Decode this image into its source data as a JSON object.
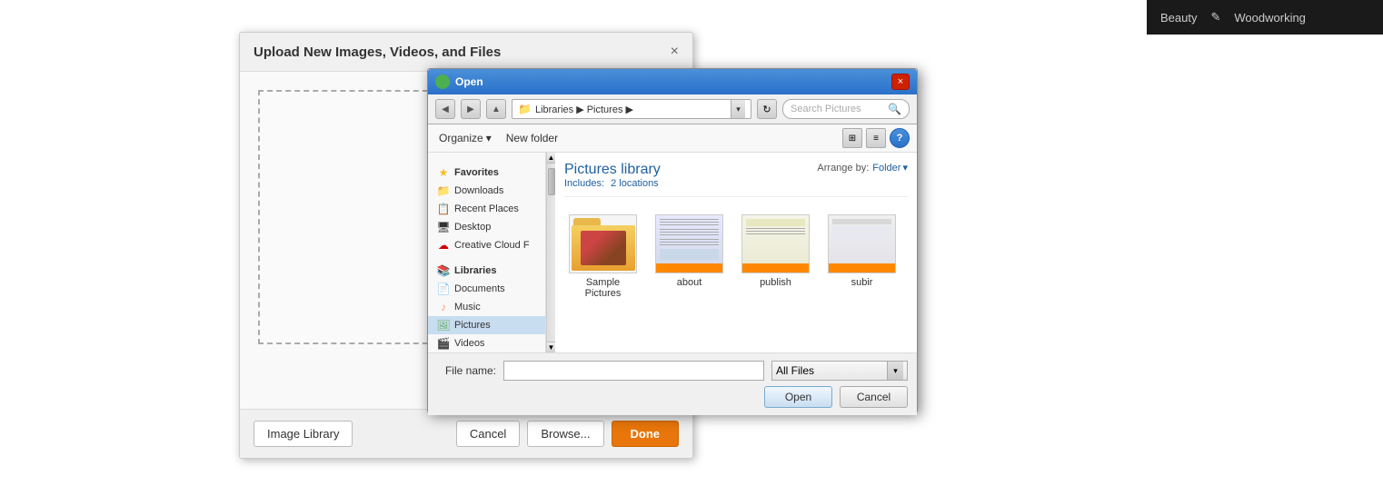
{
  "page": {
    "background_color": "#f0f0f0"
  },
  "top_nav": {
    "items": [
      {
        "label": "Beauty",
        "icon": "beauty-icon"
      },
      {
        "label": "Woodworking",
        "icon": "woodworking-icon"
      }
    ]
  },
  "upload_dialog": {
    "title": "Upload New Images, Videos, and Files",
    "close_label": "×",
    "footer": {
      "image_library_label": "Image Library",
      "cancel_label": "Cancel",
      "browse_label": "Browse...",
      "done_label": "Done"
    }
  },
  "open_dialog": {
    "title": "Open",
    "close_label": "×",
    "address_bar": {
      "path": "Libraries ▶ Pictures ▶",
      "path_parts": [
        "Libraries",
        "Pictures"
      ],
      "search_placeholder": "Search Pictures"
    },
    "toolbar": {
      "organize_label": "Organize",
      "organize_arrow": "▾",
      "new_folder_label": "New folder"
    },
    "sidebar": {
      "sections": [
        {
          "label": "Favorites",
          "icon": "star-icon",
          "items": [
            {
              "label": "Downloads",
              "icon": "folder-icon"
            },
            {
              "label": "Recent Places",
              "icon": "folder-icon"
            },
            {
              "label": "Desktop",
              "icon": "desktop-icon"
            },
            {
              "label": "Creative Cloud F",
              "icon": "cloud-icon"
            }
          ]
        },
        {
          "label": "Libraries",
          "icon": "library-icon",
          "items": [
            {
              "label": "Documents",
              "icon": "document-icon"
            },
            {
              "label": "Music",
              "icon": "music-icon"
            },
            {
              "label": "Pictures",
              "icon": "picture-icon"
            },
            {
              "label": "Videos",
              "icon": "video-icon"
            }
          ]
        }
      ]
    },
    "main_area": {
      "library_title": "Pictures library",
      "library_includes": "Includes:",
      "library_locations": "2 locations",
      "arrange_by_label": "Arrange by:",
      "arrange_by_value": "Folder",
      "files": [
        {
          "name": "Sample Pictures",
          "type": "folder",
          "has_image": true
        },
        {
          "name": "about",
          "type": "screenshot"
        },
        {
          "name": "publish",
          "type": "screenshot"
        },
        {
          "name": "subir",
          "type": "screenshot"
        }
      ]
    },
    "bottom": {
      "file_name_label": "File name:",
      "file_name_value": "",
      "file_type_label": "All Files",
      "open_label": "Open",
      "cancel_label": "Cancel"
    }
  }
}
